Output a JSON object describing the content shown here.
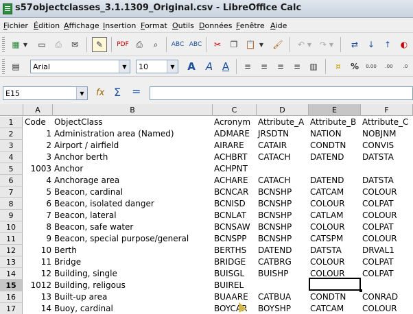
{
  "window": {
    "title": "s57objectclasses_3.1.1309_Original.csv - LibreOffice Calc"
  },
  "menu": [
    "Fichier",
    "Édition",
    "Affichage",
    "Insertion",
    "Format",
    "Outils",
    "Données",
    "Fenêtre",
    "Aide"
  ],
  "toolbar": {
    "font_name": "Arial",
    "font_size": "10",
    "percent_label": "%"
  },
  "formula_bar": {
    "cell_ref": "E15",
    "sigma": "Σ",
    "equals": "="
  },
  "sheet": {
    "selected_cell": "E15",
    "columns": [
      "A",
      "B",
      "C",
      "D",
      "E",
      "F"
    ],
    "row_numbers": [
      "1",
      "2",
      "3",
      "4",
      "5",
      "6",
      "7",
      "8",
      "9",
      "10",
      "11",
      "12",
      "13",
      "14",
      "15",
      "16",
      "17"
    ],
    "rows": [
      [
        "Code",
        "ObjectClass",
        "Acronym",
        "Attribute_A",
        "Attribute_B",
        "Attribute_C"
      ],
      [
        "1",
        "Administration area (Named)",
        "ADMARE",
        "JRSDTN",
        "NATION",
        "NOBJNM"
      ],
      [
        "2",
        "Airport / airfield",
        "AIRARE",
        "CATAIR",
        "CONDTN",
        "CONVIS"
      ],
      [
        "3",
        "Anchor berth",
        "ACHBRT",
        "CATACH",
        "DATEND",
        "DATSTA"
      ],
      [
        "1003",
        "Anchor",
        "ACHPNT",
        "",
        "",
        ""
      ],
      [
        "4",
        "Anchorage area",
        "ACHARE",
        "CATACH",
        "DATEND",
        "DATSTA"
      ],
      [
        "5",
        "Beacon, cardinal",
        "BCNCAR",
        "BCNSHP",
        "CATCAM",
        "COLOUR"
      ],
      [
        "6",
        "Beacon, isolated danger",
        "BCNISD",
        "BCNSHP",
        "COLOUR",
        "COLPAT"
      ],
      [
        "7",
        "Beacon, lateral",
        "BCNLAT",
        "BCNSHP",
        "CATLAM",
        "COLOUR"
      ],
      [
        "8",
        "Beacon, safe water",
        "BCNSAW",
        "BCNSHP",
        "COLOUR",
        "COLPAT"
      ],
      [
        "9",
        "Beacon, special purpose/general",
        "BCNSPP",
        "BCNSHP",
        "CATSPM",
        "COLOUR"
      ],
      [
        "10",
        "Berth",
        "BERTHS",
        "DATEND",
        "DATSTA",
        "DRVAL1"
      ],
      [
        "11",
        "Bridge",
        "BRIDGE",
        "CATBRG",
        "COLOUR",
        "COLPAT"
      ],
      [
        "12",
        "Building, single",
        "BUISGL",
        "BUISHP",
        "COLOUR",
        "COLPAT"
      ],
      [
        "1012",
        "Building, religous",
        "BUIREL",
        "",
        "",
        ""
      ],
      [
        "13",
        "Built-up area",
        "BUAARE",
        "CATBUA",
        "CONDTN",
        "CONRAD"
      ],
      [
        "14",
        "Buoy, cardinal",
        "BOYCAR",
        "BOYSHP",
        "CATCAM",
        "COLOUR"
      ]
    ]
  },
  "colors": {
    "title_bg": "#c9d4e0",
    "chrome_bg": "#efefef",
    "header_bg": "#e8e8e8",
    "header_selected": "#c6c6c6"
  }
}
